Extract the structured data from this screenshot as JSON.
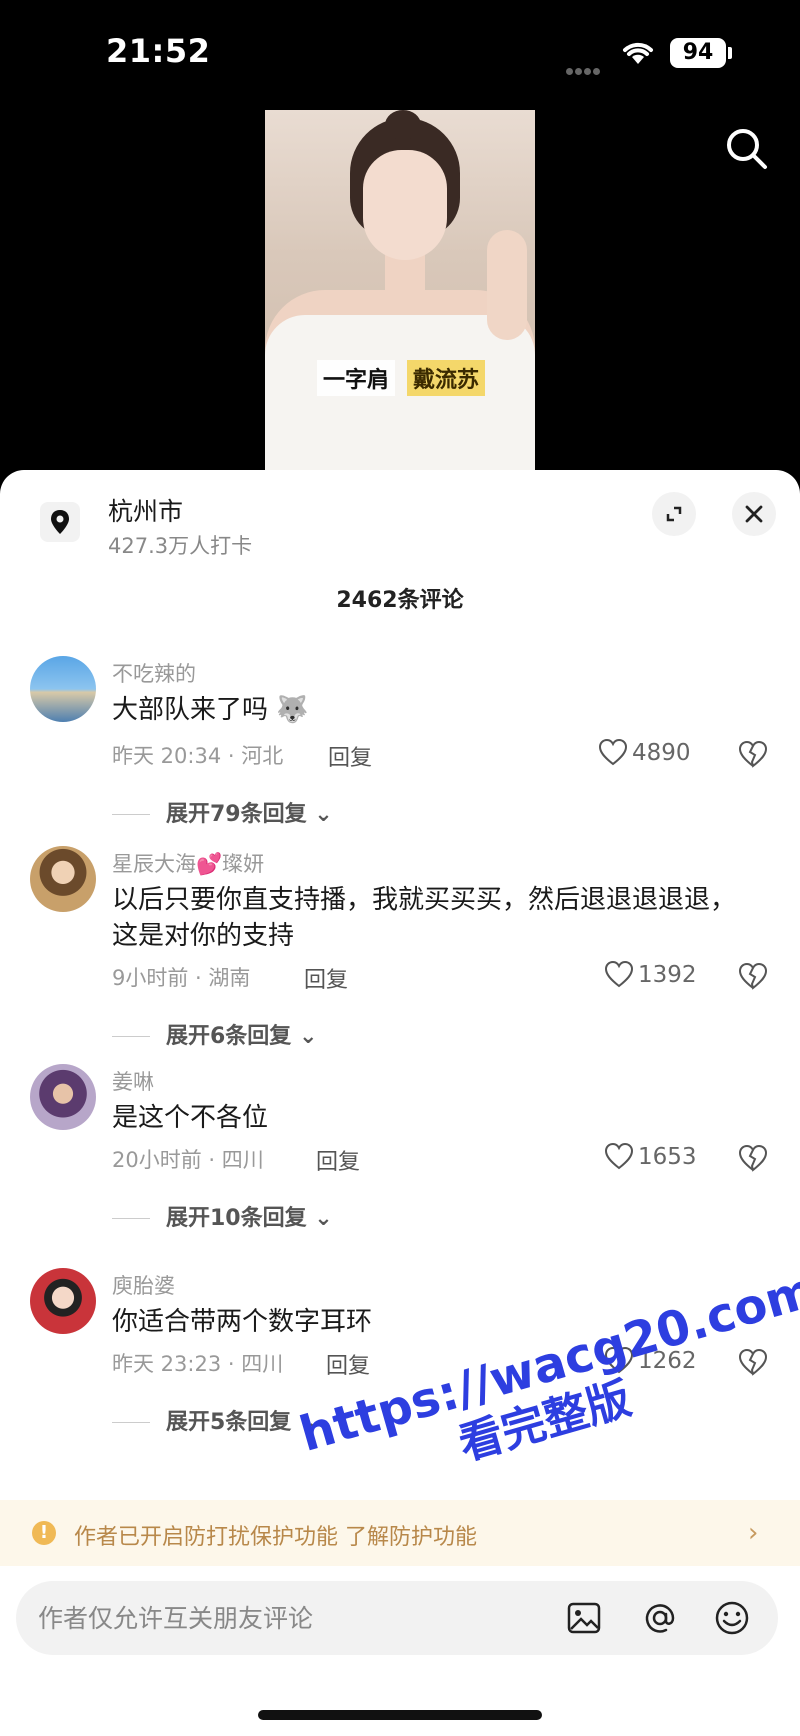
{
  "status": {
    "time": "21:52",
    "battery": "94"
  },
  "video": {
    "caption_left": "一字肩",
    "caption_right": "戴流苏"
  },
  "location": {
    "name": "杭州市",
    "checkins": "427.3万人打卡"
  },
  "comment_count": "2462条评论",
  "comments": [
    {
      "user": "不吃辣的",
      "text": "大部队来了吗 🐺",
      "meta": "昨天 20:34 · 河北",
      "reply": "回复",
      "likes": "4890",
      "expand": "展开79条回复"
    },
    {
      "user": "星辰大海💕璨妍",
      "text": "以后只要你直支持播，我就买买买，然后退退退退退，这是对你的支持",
      "meta": "9小时前 · 湖南",
      "reply": "回复",
      "likes": "1392",
      "expand": "展开6条回复"
    },
    {
      "user": "姜啉",
      "text": "是这个不各位",
      "meta": "20小时前 · 四川",
      "reply": "回复",
      "likes": "1653",
      "expand": "展开10条回复"
    },
    {
      "user": "庾胎婆",
      "text": "你适合带两个数字耳环",
      "meta": "昨天 23:23 · 四川",
      "reply": "回复",
      "likes": "1262",
      "expand": "展开5条回复"
    }
  ],
  "notice": {
    "text": "作者已开启防打扰保护功能 了解防护功能"
  },
  "input": {
    "placeholder": "作者仅允许互关朋友评论"
  },
  "watermark": {
    "line1": "https://wacg20.com",
    "line2": "看完整版"
  },
  "icons": {
    "location": "location-pin-icon",
    "expand": "expand-icon",
    "close": "close-icon",
    "like": "heart-icon",
    "dislike": "broken-heart-icon",
    "image": "image-icon",
    "mention": "at-icon",
    "emoji": "emoji-icon",
    "search": "search-icon"
  },
  "colors": {
    "accent_notice": "#f0b955",
    "watermark": "#2d3ee0"
  }
}
